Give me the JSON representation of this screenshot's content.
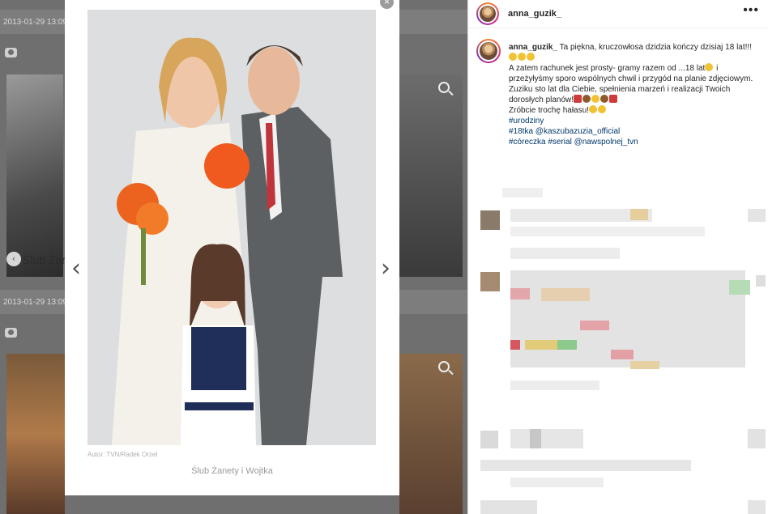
{
  "gallery": {
    "date_top": "2013-01-29 13:09",
    "date_mid": "2013-01-29 13:09",
    "side_label": "Ślub Żanet",
    "photo_credit": "Autor: TVN/Radek Orzeł",
    "photo_caption": "Ślub Żanety i Wojtka",
    "close_icon": "×",
    "prev_arrow": "‹",
    "next_arrow": "›"
  },
  "instagram": {
    "header_username": "anna_guzik_",
    "more_icon": "•••",
    "post": {
      "username": "anna_guzik_",
      "line1": "Ta piękna, kruczowłosa dzidzia kończy dzisiaj 18 lat!!!",
      "line2": "A zatem rachunek jest prosty- gramy razem od ...18 lat",
      "line3": "i przeżyłyśmy sporo wspólnych chwil i przygód na planie zdjęciowym.",
      "line4": "Zuziku sto lat dla Ciebie, spełnienia marzeń i realizacji Twoich dorosłych planów!",
      "line5": "Zróbcie trochę hałasu!",
      "hashtags": [
        "#urodziny",
        "#18tka @kaszubazuzia_official",
        "#córeczka #serial @nawspolnej_tvn"
      ]
    }
  }
}
